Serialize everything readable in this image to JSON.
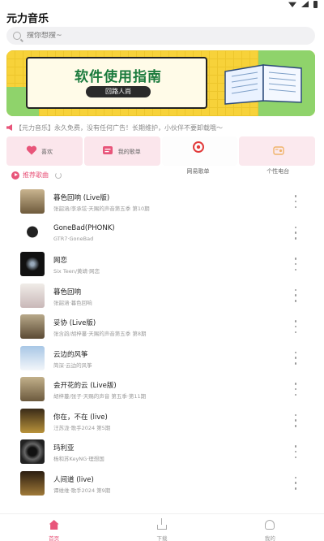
{
  "app": {
    "title": "元力音乐"
  },
  "search": {
    "placeholder": "搜你想搜~"
  },
  "banner": {
    "heading": "软件使用指南",
    "sub": "回路人尚"
  },
  "notice": {
    "text": "【元力音乐】永久免费，没有任何广告！长期维护，小伙伴不要卸载哦～"
  },
  "quick_nav": [
    {
      "label": "喜欢",
      "icon": "heart-icon"
    },
    {
      "label": "我的歌单",
      "icon": "playlist-icon"
    },
    {
      "label": "网易歌单",
      "icon": "netease-icon"
    },
    {
      "label": "个性电台",
      "icon": "radio-icon"
    }
  ],
  "section": {
    "title": "推荐歌曲"
  },
  "songs": [
    {
      "title": "暮色回响 (Live版)",
      "sub": "张韶涵/李承铉·天赐的声音第五季 第10期"
    },
    {
      "title": "GoneBad(PHONK)",
      "sub": "GTR7·GoneBad"
    },
    {
      "title": "网恋",
      "sub": "Six Teen/黄靖·网恋"
    },
    {
      "title": "暮色回响",
      "sub": "张韶涵·暮色回响"
    },
    {
      "title": "妥协 (Live版)",
      "sub": "张含韵/胡梓蔓·天赐的声音第五季 第8期"
    },
    {
      "title": "云边的风筝",
      "sub": "简深·云边的风筝"
    },
    {
      "title": "会开花的云 (Live版)",
      "sub": "胡梓蔓/张子·天赐的声音 第五季·第11期"
    },
    {
      "title": "你在，不在 (live)",
      "sub": "汪苏泷·歌手2024 第5期"
    },
    {
      "title": "玛利亚",
      "sub": "杨和苏KeyNG·理想国"
    },
    {
      "title": "人间道 (live)",
      "sub": "谭维维·歌手2024 第9期"
    }
  ],
  "bottom_nav": [
    {
      "label": "首页",
      "active": true
    },
    {
      "label": "下载",
      "active": false
    },
    {
      "label": "我的",
      "active": false
    }
  ],
  "colors": {
    "accent": "#e8557a",
    "banner_yellow": "#f7d23a",
    "banner_green": "#8fd36b"
  }
}
